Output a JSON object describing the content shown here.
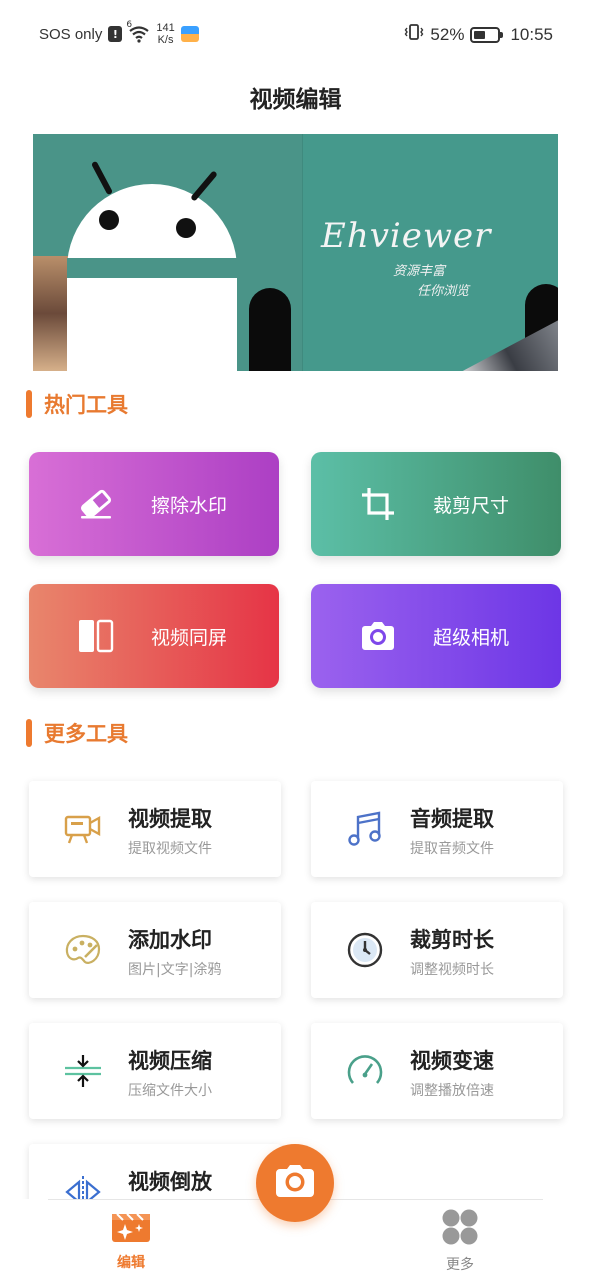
{
  "status_bar": {
    "carrier": "SOS only",
    "alert": "!",
    "network_badge": "6",
    "speed_value": "141",
    "speed_unit": "K/s",
    "battery_percent": "52%",
    "battery_level": 0.52,
    "time": "10:55"
  },
  "header": {
    "title": "视频编辑"
  },
  "banner": {
    "app_name": "Ehviewer",
    "line1": "资源丰富",
    "line2": "任你浏览"
  },
  "sections": {
    "hot": "热门工具",
    "more": "更多工具"
  },
  "hot_tools": [
    {
      "label": "擦除水印",
      "icon": "eraser-icon",
      "colors": [
        "#d86fd6",
        "#ac3fc4"
      ]
    },
    {
      "label": "裁剪尺寸",
      "icon": "crop-icon",
      "colors": [
        "#5cbfa7",
        "#3f8e6a"
      ]
    },
    {
      "label": "视频同屏",
      "icon": "split-screen-icon",
      "colors": [
        "#e8866c",
        "#e63446"
      ]
    },
    {
      "label": "超级相机",
      "icon": "camera-icon",
      "colors": [
        "#9b62ee",
        "#6d36e6"
      ]
    }
  ],
  "more_tools": [
    {
      "title": "视频提取",
      "subtitle": "提取视频文件",
      "icon": "video-camera-icon"
    },
    {
      "title": "音频提取",
      "subtitle": "提取音频文件",
      "icon": "music-note-icon"
    },
    {
      "title": "添加水印",
      "subtitle": "图片|文字|涂鸦",
      "icon": "palette-icon"
    },
    {
      "title": "裁剪时长",
      "subtitle": "调整视频时长",
      "icon": "clock-icon"
    },
    {
      "title": "视频压缩",
      "subtitle": "压缩文件大小",
      "icon": "compress-icon"
    },
    {
      "title": "视频变速",
      "subtitle": "调整播放倍速",
      "icon": "speedometer-icon"
    },
    {
      "title": "视频倒放",
      "subtitle": "",
      "icon": "reverse-icon"
    }
  ],
  "bottom_nav": {
    "edit_label": "编辑",
    "more_label": "更多"
  },
  "colors": {
    "accent": "#ee7a2f",
    "section_title": "#e87a30",
    "nav_inactive": "#888888"
  }
}
